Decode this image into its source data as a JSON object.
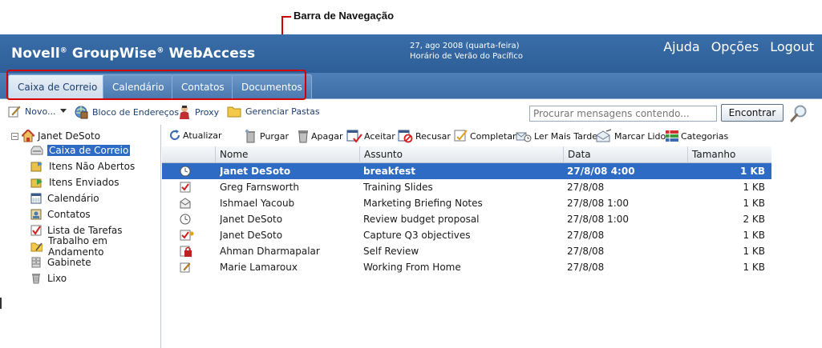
{
  "annotation": {
    "label": "Barra de Navegação"
  },
  "header": {
    "brand_part1": "Novell",
    "brand_part2": " GroupWise",
    "brand_part3": " WebAccess",
    "reg_mark": "®",
    "date_line1": "27, ago 2008 (quarta-feira)",
    "date_line2": "Horário de Verão do Pacífico",
    "links": [
      "Ajuda",
      "Opções",
      "Logout"
    ]
  },
  "tabs": [
    "Caixa de Correio",
    "Calendário",
    "Contatos",
    "Documentos"
  ],
  "toolbar": {
    "new_label": "Novo...",
    "address_book_label": "Bloco de Endereços",
    "proxy_label": "Proxy",
    "manage_folders_label": "Gerenciar Pastas",
    "search_placeholder": "Procurar mensagens contendo...",
    "search_button": "Encontrar"
  },
  "sidebar": {
    "user": "Janet DeSoto",
    "toggle": "−",
    "folders": [
      "Caixa de Correio",
      "Itens Não Abertos",
      "Itens Enviados",
      "Calendário",
      "Contatos",
      "Lista de Tarefas",
      "Trabalho em Andamento",
      "Gabinete",
      "Lixo"
    ]
  },
  "actions": [
    "Atualizar",
    "Purgar",
    "Apagar",
    "Aceitar",
    "Recusar",
    "Completar",
    "Ler Mais Tarde",
    "Marcar Lido",
    "Categorias"
  ],
  "table": {
    "columns": [
      "Nome",
      "Assunto",
      "Data",
      "Tamanho"
    ],
    "rows": [
      {
        "icon": "appointment-icon",
        "name": "Janet DeSoto",
        "subject": "breakfest",
        "date": "27/8/08 4:00",
        "size": "1 KB"
      },
      {
        "icon": "task-icon",
        "name": "Greg Farnsworth",
        "subject": "Training Slides",
        "date": "27/8/08",
        "size": "1 KB"
      },
      {
        "icon": "mail-icon",
        "name": "Ishmael Yacoub",
        "subject": "Marketing Briefing Notes",
        "date": "27/8/08 1:00",
        "size": "1 KB"
      },
      {
        "icon": "appointment-icon",
        "name": "Janet DeSoto",
        "subject": "Review budget proposal",
        "date": "27/8/08 1:00",
        "size": "2 KB"
      },
      {
        "icon": "task-flag-icon",
        "name": "Janet DeSoto",
        "subject": "Capture Q3 objectives",
        "date": "27/8/08",
        "size": "1 KB"
      },
      {
        "icon": "locked-mail-icon",
        "name": "Ahman Dharmapalar",
        "subject": "Self Review",
        "date": "27/8/08",
        "size": "1 KB"
      },
      {
        "icon": "note-icon",
        "name": "Marie Lamaroux",
        "subject": "Working From Home",
        "date": "27/8/08",
        "size": "1 KB"
      }
    ]
  }
}
